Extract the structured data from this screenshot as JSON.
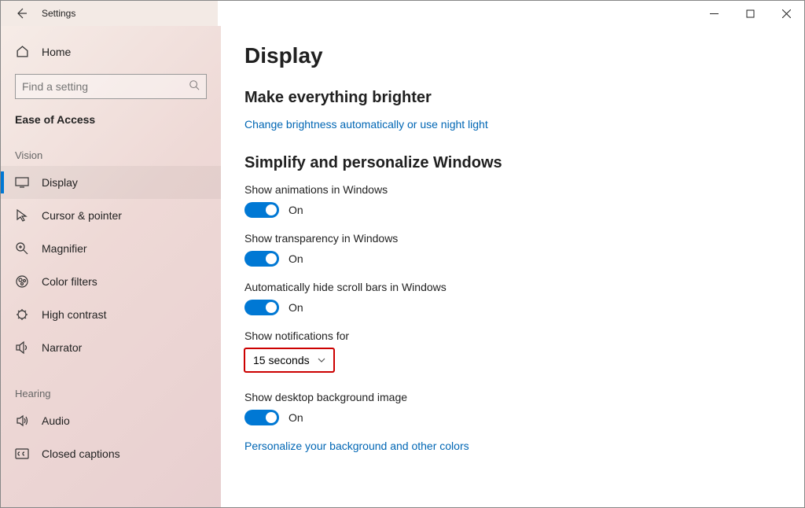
{
  "titlebar": {
    "title": "Settings"
  },
  "sidebar": {
    "home_label": "Home",
    "search_placeholder": "Find a setting",
    "section": "Ease of Access",
    "groups": [
      {
        "label": "Vision",
        "items": [
          {
            "key": "display",
            "label": "Display",
            "active": true
          },
          {
            "key": "cursor",
            "label": "Cursor & pointer"
          },
          {
            "key": "magnifier",
            "label": "Magnifier"
          },
          {
            "key": "colorfilters",
            "label": "Color filters"
          },
          {
            "key": "highcontrast",
            "label": "High contrast"
          },
          {
            "key": "narrator",
            "label": "Narrator"
          }
        ]
      },
      {
        "label": "Hearing",
        "items": [
          {
            "key": "audio",
            "label": "Audio"
          },
          {
            "key": "closedcaptions",
            "label": "Closed captions"
          }
        ]
      }
    ]
  },
  "content": {
    "title": "Display",
    "s1_title": "Make everything brighter",
    "s1_link": "Change brightness automatically or use night light",
    "s2_title": "Simplify and personalize Windows",
    "anim_label": "Show animations in Windows",
    "trans_label": "Show transparency in Windows",
    "scroll_label": "Automatically hide scroll bars in Windows",
    "notif_label": "Show notifications for",
    "notif_value": "15 seconds",
    "bg_label": "Show desktop background image",
    "personalize_link": "Personalize your background and other colors",
    "on": "On"
  }
}
